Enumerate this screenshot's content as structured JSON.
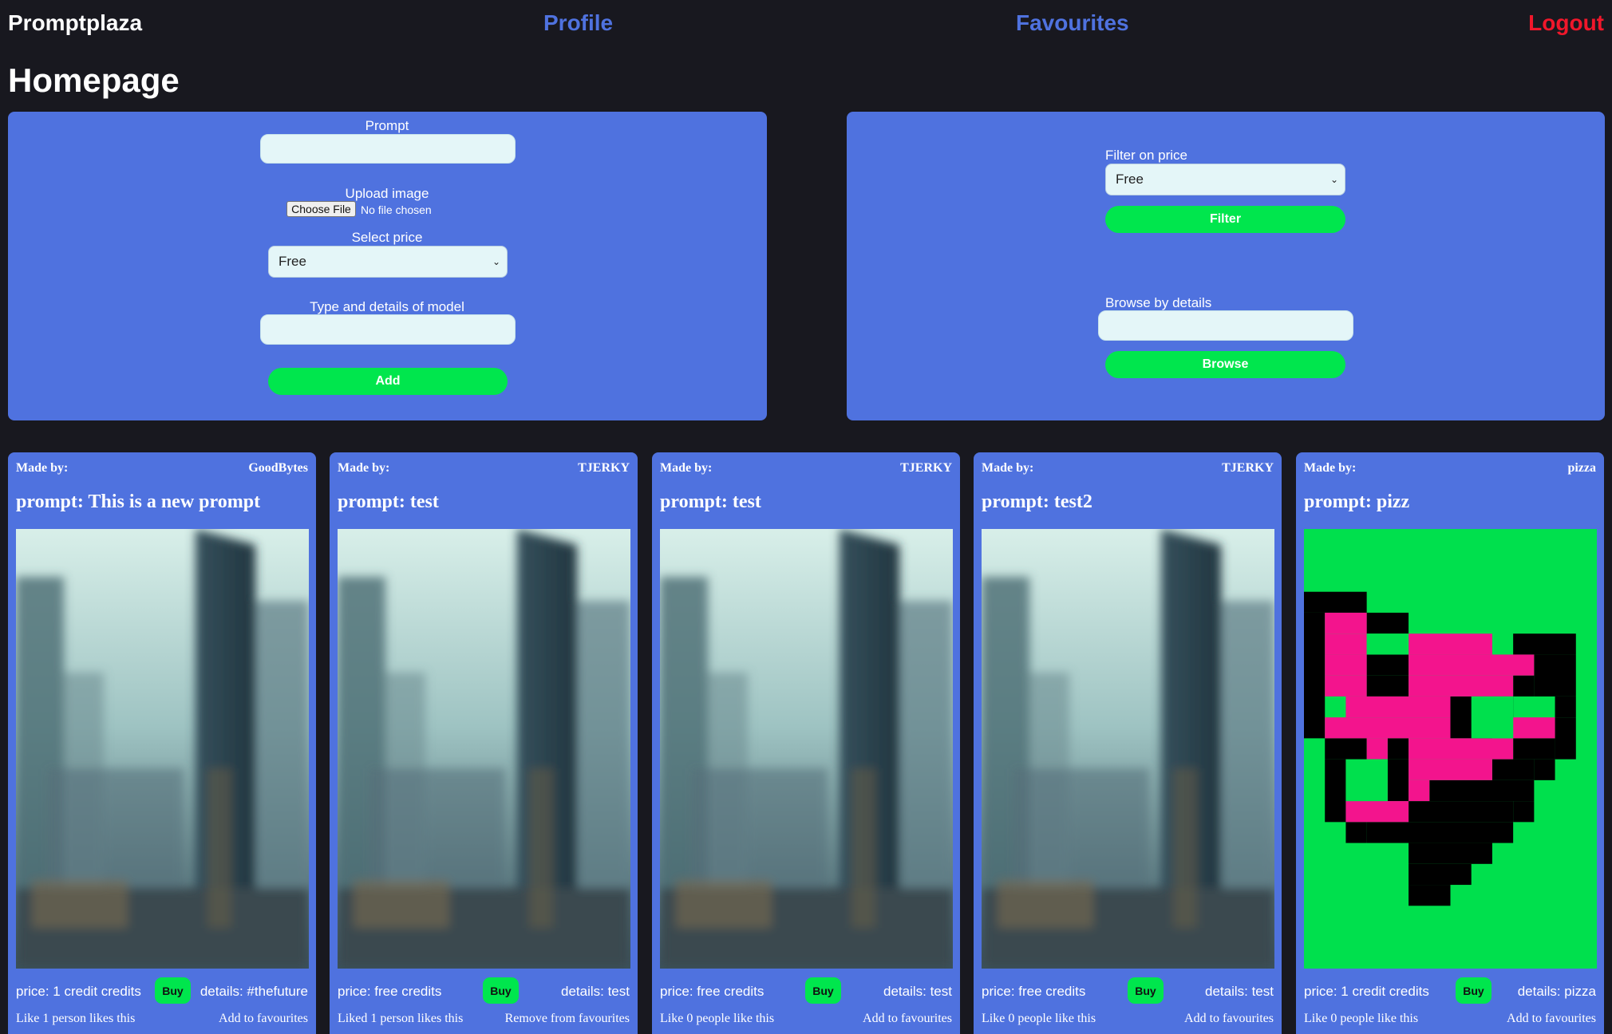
{
  "nav": {
    "brand": "Promptplaza",
    "profile": "Profile",
    "favourites": "Favourites",
    "logout": "Logout"
  },
  "page_title": "Homepage",
  "add_form": {
    "prompt_label": "Prompt",
    "prompt_value": "",
    "upload_label": "Upload image",
    "file_button": "Choose File",
    "file_status": "No file chosen",
    "price_label": "Select price",
    "price_value": "Free",
    "model_label": "Type and details of model",
    "model_value": "",
    "add_button": "Add"
  },
  "filter_form": {
    "filter_label": "Filter on price",
    "filter_value": "Free",
    "filter_button": "Filter",
    "browse_label": "Browse by details",
    "browse_value": "",
    "browse_button": "Browse"
  },
  "colors": {
    "background": "#18181f",
    "panel": "#4f72df",
    "accent_green": "#00e64d",
    "logout_red": "#f0172b",
    "nav_link": "#4f72df"
  },
  "cards": [
    {
      "made_by_label": "Made by:",
      "author": "GoodBytes",
      "prompt": "prompt: This is a new prompt",
      "image": "city-skyscrapers-image",
      "price": "price: 1 credit credits",
      "buy": "Buy",
      "details": "details: #thefuture",
      "likes": "Like 1 person likes this",
      "favourite_action": "Add to favourites"
    },
    {
      "made_by_label": "Made by:",
      "author": "TJERKY",
      "prompt": "prompt: test",
      "image": "city-skyscrapers-image",
      "price": "price: free credits",
      "buy": "Buy",
      "details": "details: test",
      "likes": "Liked 1 person likes this",
      "favourite_action": "Remove from favourites"
    },
    {
      "made_by_label": "Made by:",
      "author": "TJERKY",
      "prompt": "prompt: test",
      "image": "city-skyscrapers-image",
      "price": "price: free credits",
      "buy": "Buy",
      "details": "details: test",
      "likes": "Like 0 people like this",
      "favourite_action": "Add to favourites"
    },
    {
      "made_by_label": "Made by:",
      "author": "TJERKY",
      "prompt": "prompt: test2",
      "image": "city-skyscrapers-image",
      "price": "price: free credits",
      "buy": "Buy",
      "details": "details: test",
      "likes": "Like 0 people like this",
      "favourite_action": "Add to favourites"
    },
    {
      "made_by_label": "Made by:",
      "author": "pizza",
      "prompt": "prompt: pizz",
      "image": "pixel-pizza-image",
      "price": "price: 1 credit credits",
      "buy": "Buy",
      "details": "details: pizza",
      "likes": "Like 0 people like this",
      "favourite_action": "Add to favourites"
    }
  ]
}
